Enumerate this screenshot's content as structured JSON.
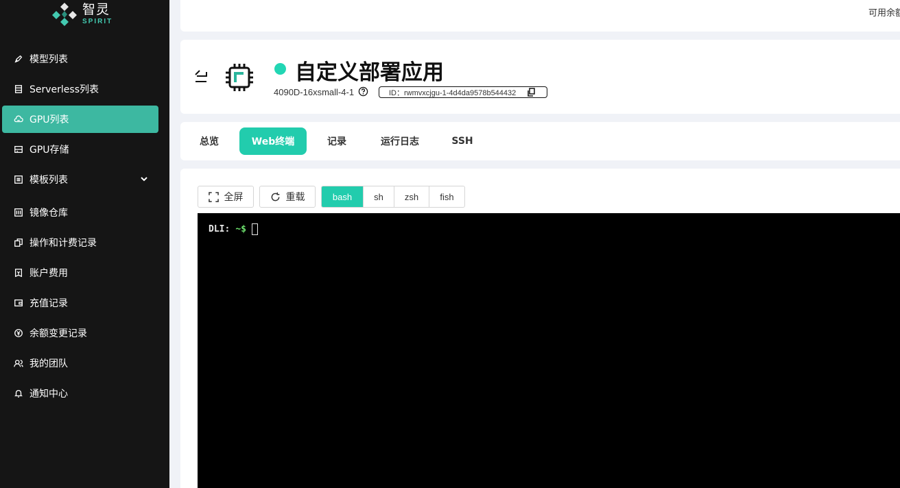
{
  "brand": {
    "cn": "智灵",
    "en": "SPIRIT",
    "accent": "#43c9b0"
  },
  "sidebar": {
    "items": [
      {
        "label": "模型列表",
        "icon": "rocket-icon"
      },
      {
        "label": "Serverless列表",
        "icon": "server-icon"
      },
      {
        "label": "GPU列表",
        "icon": "cloud-icon",
        "active": true
      },
      {
        "label": "GPU存储",
        "icon": "storage-icon"
      },
      {
        "label": "模板列表",
        "icon": "template-icon",
        "expandable": true
      },
      {
        "label": "镜像仓库",
        "icon": "image-repo-icon"
      },
      {
        "label": "操作和计费记录",
        "icon": "billing-icon"
      },
      {
        "label": "账户费用",
        "icon": "invoice-icon"
      },
      {
        "label": "充值记录",
        "icon": "wallet-icon"
      },
      {
        "label": "余额变更记录",
        "icon": "yen-icon"
      },
      {
        "label": "我的团队",
        "icon": "team-icon"
      },
      {
        "label": "通知中心",
        "icon": "bell-icon"
      }
    ]
  },
  "topbar": {
    "balance": "可用余额"
  },
  "header": {
    "title": "自定义部署应用",
    "status_color": "#22d6b4",
    "spec": "4090D-16xsmall-4-1",
    "id_label": "ID：rwmvxcjgu-1-4d4da9578b544432"
  },
  "tabs": [
    {
      "label": "总览"
    },
    {
      "label": "Web终端",
      "active": true
    },
    {
      "label": "记录"
    },
    {
      "label": "运行日志"
    },
    {
      "label": "SSH"
    }
  ],
  "toolbar": {
    "fullscreen_label": "全屏",
    "reload_label": "重载",
    "shells": [
      "bash",
      "sh",
      "zsh",
      "fish"
    ],
    "selected_shell": "bash"
  },
  "terminal": {
    "prompt_host": "DLI:",
    "prompt_path": "~$"
  }
}
